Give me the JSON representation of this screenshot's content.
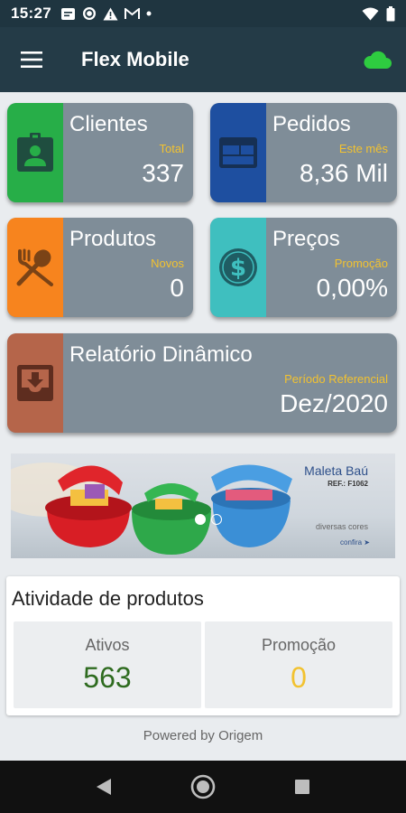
{
  "status_bar": {
    "time": "15:27",
    "left_icons": [
      "message-icon",
      "sync-icon",
      "warning-icon",
      "gmail-icon",
      "dot-icon"
    ],
    "right_icons": [
      "wifi-icon",
      "battery-icon"
    ]
  },
  "app_bar": {
    "title": "Flex Mobile",
    "menu_icon": "hamburger-menu-icon",
    "cloud_icon": "cloud-icon",
    "cloud_color": "#2ecc40"
  },
  "cards": {
    "clientes": {
      "title": "Clientes",
      "subtitle": "Total",
      "value": "337",
      "icon": "contact-badge-icon",
      "color": "#27ae48"
    },
    "pedidos": {
      "title": "Pedidos",
      "subtitle": "Este mês",
      "value": "8,36 Mil",
      "icon": "order-window-icon",
      "color": "#1e4fa0"
    },
    "produtos": {
      "title": "Produtos",
      "subtitle": "Novos",
      "value": "0",
      "icon": "utensils-icon",
      "color": "#f7841e"
    },
    "precos": {
      "title": "Preços",
      "subtitle": "Promoção",
      "value": "0,00%",
      "icon": "dollar-circle-icon",
      "color": "#3fbfbf"
    },
    "relatorio": {
      "title": "Relatório Dinâmico",
      "subtitle": "Período Referencial",
      "value": "Dez/2020",
      "icon": "inbox-download-icon",
      "color": "#b5654a"
    }
  },
  "banner": {
    "title": "Maleta Baú",
    "ref": "REF.: F1062",
    "cores": "diversas cores",
    "confira": "confira",
    "active_slide": 1,
    "slides": 2
  },
  "activity": {
    "title": "Atividade de produtos",
    "ativos": {
      "label": "Ativos",
      "value": "563",
      "color": "#2e6b1f"
    },
    "promocao": {
      "label": "Promoção",
      "value": "0",
      "color": "#f2c230"
    }
  },
  "footer": {
    "powered": "Powered by Origem"
  },
  "nav": {
    "back": "back-icon",
    "home": "home-icon",
    "recents": "recents-icon"
  }
}
